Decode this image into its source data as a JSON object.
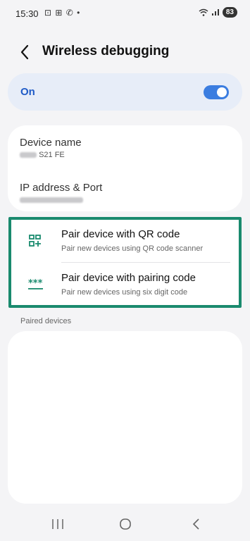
{
  "status": {
    "time": "15:30",
    "left_icons": "⊡ ⊞ ✆ •",
    "battery": "83"
  },
  "header": {
    "title": "Wireless debugging"
  },
  "toggle": {
    "label": "On",
    "enabled": true
  },
  "device": {
    "name_label": "Device name",
    "name_value": "S21 FE",
    "ip_label": "IP address & Port"
  },
  "pairing": {
    "qr": {
      "title": "Pair device with QR code",
      "subtitle": "Pair new devices using QR code scanner"
    },
    "code": {
      "title": "Pair device with pairing code",
      "subtitle": "Pair new devices using six digit code"
    }
  },
  "paired": {
    "section_label": "Paired devices"
  },
  "colors": {
    "accent": "#3b7de0",
    "highlight_border": "#1a8a6e"
  }
}
